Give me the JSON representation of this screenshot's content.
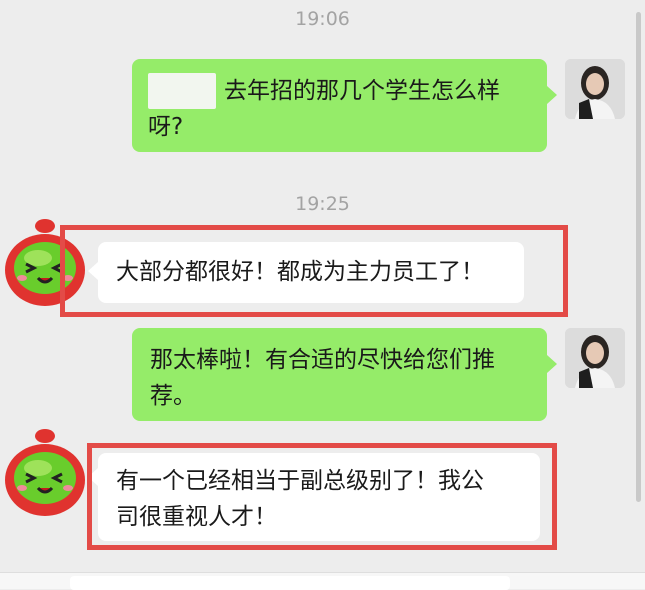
{
  "chat": {
    "timestamp_1": "19:06",
    "timestamp_2": "19:25",
    "messages": [
      {
        "side": "sent",
        "text_line1": "去年招的那几个学生怎么样",
        "text_line2": "呀?"
      },
      {
        "side": "received",
        "text": "大部分都很好！都成为主力员工了！"
      },
      {
        "side": "sent",
        "text_line1": "那太棒啦！有合适的尽快给您们推",
        "text_line2": "荐。"
      },
      {
        "side": "received",
        "text_line1": "有一个已经相当于副总级别了！我公",
        "text_line2": "司很重视人才！"
      }
    ]
  },
  "colors": {
    "sent_bubble": "#95ec69",
    "received_bubble": "#ffffff",
    "highlight_box": "#e34b47",
    "background": "#ededed"
  },
  "icons": {
    "contact_avatar": "green-cartoon-face-avatar",
    "user_avatar": "woman-portrait-avatar"
  }
}
